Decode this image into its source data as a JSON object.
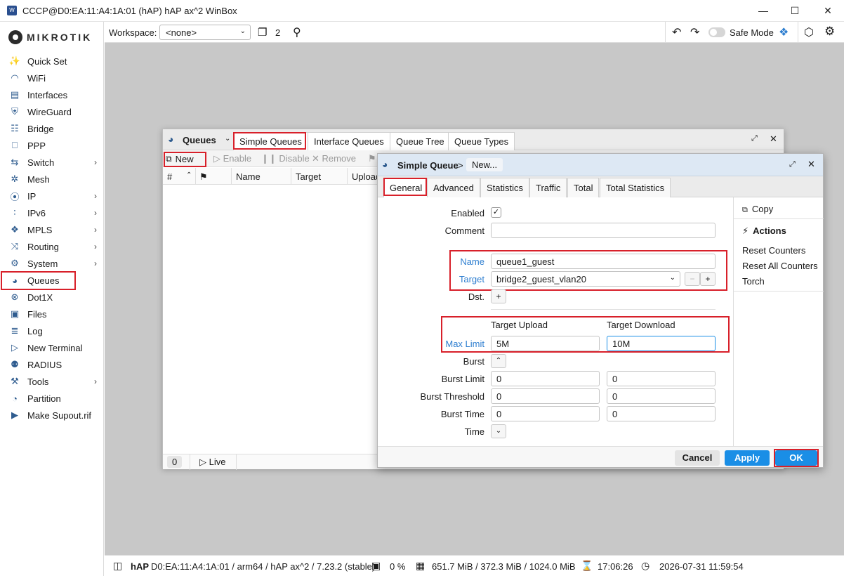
{
  "window": {
    "title": "CCCP@D0:EA:11:A4:1A:01 (hAP) hAP ax^2 WinBox"
  },
  "logo": {
    "text": "MIKROTIK"
  },
  "sidebar": {
    "items": [
      {
        "label": "Quick Set",
        "icon": "magic-wand-icon",
        "has_arrow": false
      },
      {
        "label": "WiFi",
        "icon": "wifi-icon",
        "has_arrow": false
      },
      {
        "label": "Interfaces",
        "icon": "interfaces-icon",
        "has_arrow": false
      },
      {
        "label": "WireGuard",
        "icon": "wireguard-icon",
        "has_arrow": false
      },
      {
        "label": "Bridge",
        "icon": "bridge-icon",
        "has_arrow": false
      },
      {
        "label": "PPP",
        "icon": "ppp-icon",
        "has_arrow": false
      },
      {
        "label": "Switch",
        "icon": "switch-icon",
        "has_arrow": true
      },
      {
        "label": "Mesh",
        "icon": "mesh-icon",
        "has_arrow": false
      },
      {
        "label": "IP",
        "icon": "ip-icon",
        "has_arrow": true
      },
      {
        "label": "IPv6",
        "icon": "ipv6-icon",
        "has_arrow": true
      },
      {
        "label": "MPLS",
        "icon": "mpls-icon",
        "has_arrow": true
      },
      {
        "label": "Routing",
        "icon": "routing-icon",
        "has_arrow": true
      },
      {
        "label": "System",
        "icon": "gear-icon",
        "has_arrow": true
      },
      {
        "label": "Queues",
        "icon": "gauge-icon",
        "has_arrow": false
      },
      {
        "label": "Dot1X",
        "icon": "dot1x-icon",
        "has_arrow": false
      },
      {
        "label": "Files",
        "icon": "folder-icon",
        "has_arrow": false
      },
      {
        "label": "Log",
        "icon": "log-icon",
        "has_arrow": false
      },
      {
        "label": "New Terminal",
        "icon": "terminal-icon",
        "has_arrow": false
      },
      {
        "label": "RADIUS",
        "icon": "radius-icon",
        "has_arrow": false
      },
      {
        "label": "Tools",
        "icon": "tools-icon",
        "has_arrow": true
      },
      {
        "label": "Partition",
        "icon": "partition-icon",
        "has_arrow": false
      },
      {
        "label": "Make Supout.rif",
        "icon": "supout-icon",
        "has_arrow": false
      }
    ]
  },
  "toolbar": {
    "workspace_label": "Workspace:",
    "workspace_value": "<none>",
    "windows_count": "2",
    "safe_mode_label": "Safe Mode"
  },
  "queues_window": {
    "title": "Queues",
    "tabs": [
      "Simple Queues",
      "Interface Queues",
      "Queue Tree",
      "Queue Types"
    ],
    "actions": {
      "new": "New",
      "enable": "Enable",
      "disable": "Disable",
      "remove": "Remove"
    },
    "columns": {
      "num": "#",
      "name": "Name",
      "target": "Target",
      "upload": "Upload"
    },
    "footer": {
      "count": "0",
      "live": "Live"
    }
  },
  "simple_queue": {
    "title": "Simple Queue",
    "breadcrumb_sep": ">",
    "subtitle": "New...",
    "tabs": [
      "General",
      "Advanced",
      "Statistics",
      "Traffic",
      "Total",
      "Total Statistics"
    ],
    "labels": {
      "enabled": "Enabled",
      "comment": "Comment",
      "name": "Name",
      "target": "Target",
      "dst": "Dst.",
      "target_upload": "Target Upload",
      "target_download": "Target Download",
      "max_limit": "Max Limit",
      "burst": "Burst",
      "burst_limit": "Burst Limit",
      "burst_threshold": "Burst Threshold",
      "burst_time": "Burst Time",
      "time": "Time"
    },
    "values": {
      "comment": "",
      "name": "queue1_guest",
      "target": "bridge2_guest_vlan20",
      "max_limit_upload": "5M",
      "max_limit_download": "10M",
      "burst_limit_upload": "0",
      "burst_limit_download": "0",
      "burst_threshold_upload": "0",
      "burst_threshold_download": "0",
      "burst_time_upload": "0",
      "burst_time_download": "0"
    },
    "side": {
      "copy": "Copy",
      "actions_header": "Actions",
      "reset_counters": "Reset Counters",
      "reset_all_counters": "Reset All Counters",
      "torch": "Torch"
    },
    "buttons": {
      "cancel": "Cancel",
      "apply": "Apply",
      "ok": "OK"
    }
  },
  "statusbar": {
    "device": "hAP",
    "info": "D0:EA:11:A4:1A:01 / arm64 / hAP ax^2 / 7.23.2 (stable)",
    "cpu": "0 %",
    "memory": "651.7 MiB / 372.3 MiB / 1024.0 MiB",
    "uptime": "17:06:26",
    "datetime": "2026-07-31 11:59:54"
  },
  "colors": {
    "accent": "#1a8ee6",
    "highlight": "#d8202a",
    "link": "#2f7fd0"
  }
}
